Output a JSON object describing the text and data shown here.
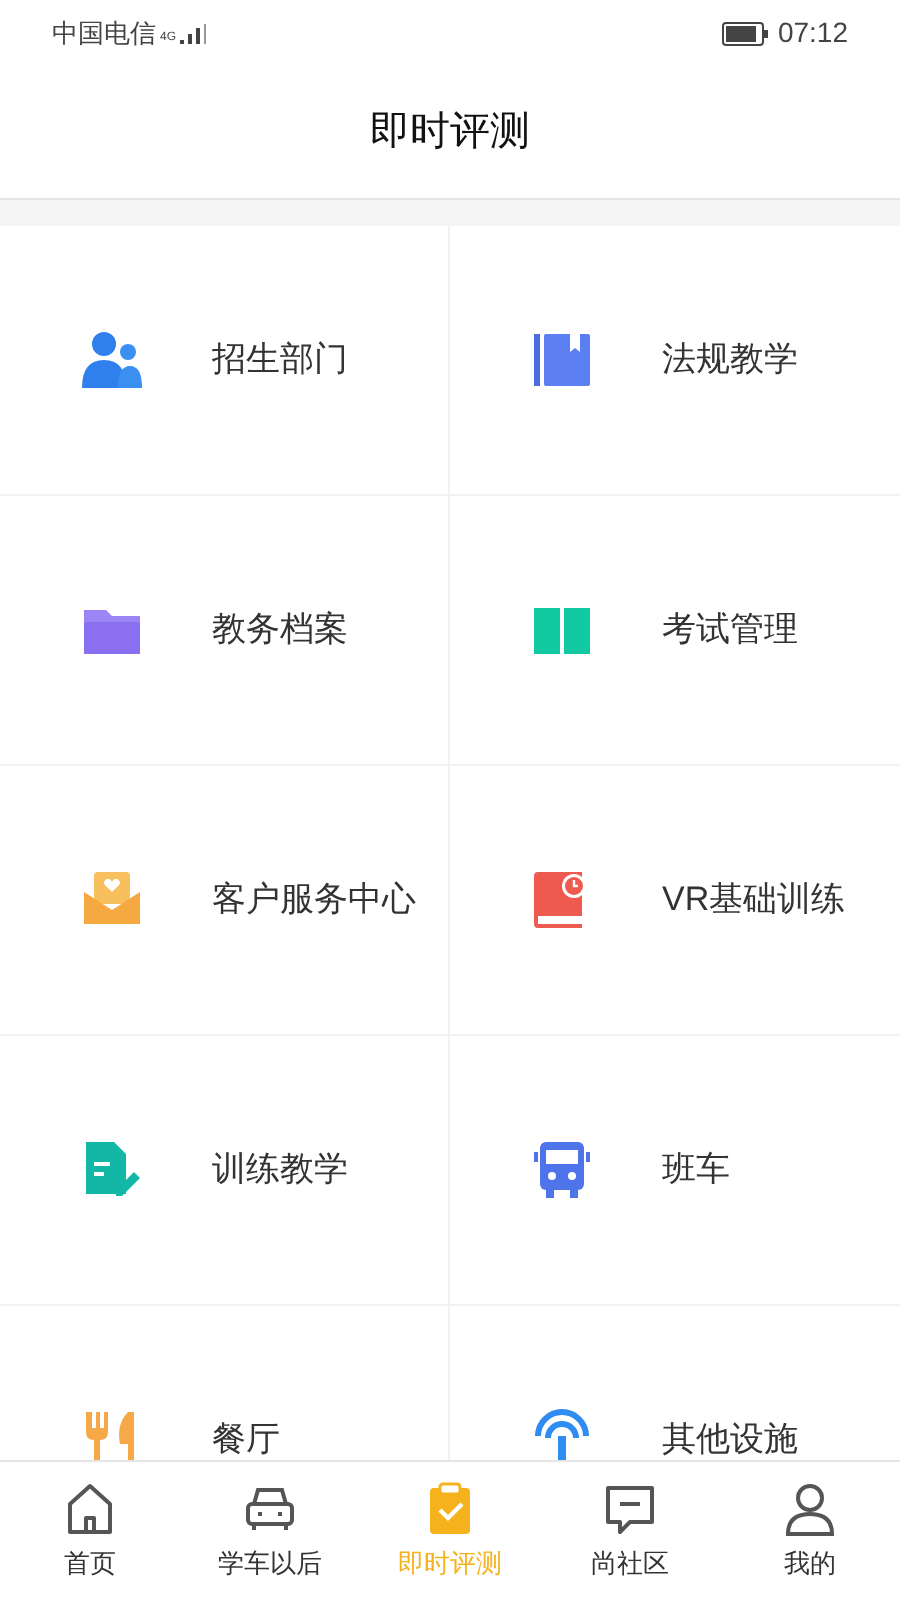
{
  "status_bar": {
    "carrier": "中国电信",
    "network": "4G",
    "time": "07:12"
  },
  "header": {
    "title": "即时评测"
  },
  "grid": [
    {
      "label": "招生部门"
    },
    {
      "label": "法规教学"
    },
    {
      "label": "教务档案"
    },
    {
      "label": "考试管理"
    },
    {
      "label": "客户服务中心"
    },
    {
      "label": "VR基础训练"
    },
    {
      "label": "训练教学"
    },
    {
      "label": "班车"
    },
    {
      "label": "餐厅"
    },
    {
      "label": "其他设施"
    }
  ],
  "tab_bar": [
    {
      "label": "首页",
      "selected": false
    },
    {
      "label": "学车以后",
      "selected": false
    },
    {
      "label": "即时评测",
      "selected": true
    },
    {
      "label": "尚社区",
      "selected": false
    },
    {
      "label": "我的",
      "selected": false
    }
  ]
}
